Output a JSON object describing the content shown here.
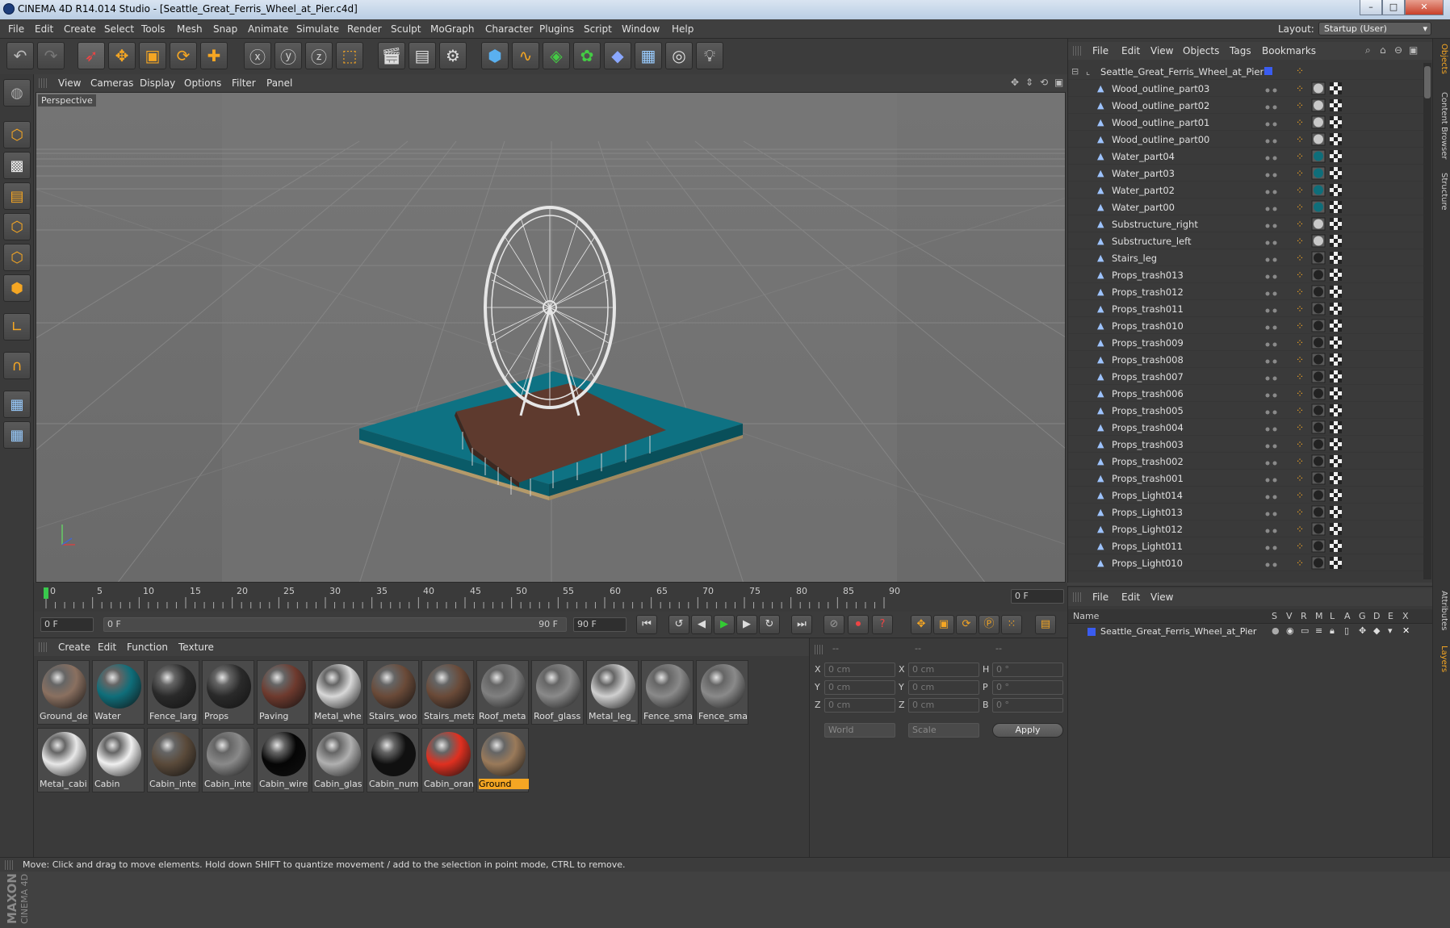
{
  "window": {
    "title": "CINEMA 4D R14.014 Studio - [Seattle_Great_Ferris_Wheel_at_Pier.c4d]",
    "min": "–",
    "max": "□",
    "close": "✕"
  },
  "menubar": {
    "items": [
      "File",
      "Edit",
      "Create",
      "Select",
      "Tools",
      "Mesh",
      "Snap",
      "Animate",
      "Simulate",
      "Render",
      "Sculpt",
      "MoGraph",
      "Character",
      "Plugins",
      "Script",
      "Window",
      "Help"
    ],
    "layout_label": "Layout:",
    "layout_value": "Startup (User)"
  },
  "viewport": {
    "menu": [
      "View",
      "Cameras",
      "Display",
      "Options",
      "Filter",
      "Panel"
    ],
    "label": "Perspective"
  },
  "timeline": {
    "ticks": [
      "0",
      "5",
      "10",
      "15",
      "20",
      "25",
      "30",
      "35",
      "40",
      "45",
      "50",
      "55",
      "60",
      "65",
      "70",
      "75",
      "80",
      "85",
      "90"
    ],
    "frame_field": "0 F"
  },
  "transport": {
    "start": "0 F",
    "range_start": "0 F",
    "range_end": "90 F",
    "end": "90 F"
  },
  "materials": {
    "menu": [
      "Create",
      "Edit",
      "Function",
      "Texture"
    ],
    "items": [
      {
        "name": "Ground_de",
        "color": "#8a7060"
      },
      {
        "name": "Water",
        "color": "#0f6e7a"
      },
      {
        "name": "Fence_larg",
        "color": "#2a2a2a"
      },
      {
        "name": "Props",
        "color": "#2a2a2a"
      },
      {
        "name": "Paving",
        "color": "#6e3a2e"
      },
      {
        "name": "Metal_whe",
        "color": "#d8d8d8"
      },
      {
        "name": "Stairs_woo",
        "color": "#6a4a38"
      },
      {
        "name": "Stairs_meta",
        "color": "#6a4a38"
      },
      {
        "name": "Roof_meta",
        "color": "#808080"
      },
      {
        "name": "Roof_glass",
        "color": "#8a8a8a"
      },
      {
        "name": "Metal_leg_",
        "color": "#d0d0d0"
      },
      {
        "name": "Fence_sma",
        "color": "#8a8a8a"
      },
      {
        "name": "Fence_sma",
        "color": "#8a8a8a"
      },
      {
        "name": "Metal_cabi",
        "color": "#e8e8e8"
      },
      {
        "name": "Cabin",
        "color": "#f0f0f0"
      },
      {
        "name": "Cabin_inte",
        "color": "#5a4a3a"
      },
      {
        "name": "Cabin_inte",
        "color": "#8a8a8a"
      },
      {
        "name": "Cabin_wire",
        "color": "#050505"
      },
      {
        "name": "Cabin_glas",
        "color": "#b0b0b0"
      },
      {
        "name": "Cabin_num",
        "color": "#101010"
      },
      {
        "name": "Cabin_oran",
        "color": "#e03020"
      },
      {
        "name": "Ground",
        "color": "#9a7a5a"
      }
    ]
  },
  "attributes": {
    "header": [
      "--",
      "--",
      "--"
    ],
    "rows": [
      {
        "a": "X",
        "av": "0 cm",
        "b": "X",
        "bv": "0 cm",
        "c": "H",
        "cv": "0 °"
      },
      {
        "a": "Y",
        "av": "0 cm",
        "b": "Y",
        "bv": "0 cm",
        "c": "P",
        "cv": "0 °"
      },
      {
        "a": "Z",
        "av": "0 cm",
        "b": "Z",
        "bv": "0 cm",
        "c": "B",
        "cv": "0 °"
      }
    ],
    "world": "World",
    "scale": "Scale",
    "apply": "Apply"
  },
  "objects": {
    "menu": [
      "File",
      "Edit",
      "View",
      "Objects",
      "Tags",
      "Bookmarks"
    ],
    "root": "Seattle_Great_Ferris_Wheel_at_Pier",
    "items": [
      {
        "name": "Wood_outline_part03",
        "mat": "#c8c8c8"
      },
      {
        "name": "Wood_outline_part02",
        "mat": "#c8c8c8"
      },
      {
        "name": "Wood_outline_part01",
        "mat": "#c8c8c8"
      },
      {
        "name": "Wood_outline_part00",
        "mat": "#c8c8c8"
      },
      {
        "name": "Water_part04",
        "mat": "#0f6e7a"
      },
      {
        "name": "Water_part03",
        "mat": "#0f6e7a"
      },
      {
        "name": "Water_part02",
        "mat": "#0f6e7a"
      },
      {
        "name": "Water_part00",
        "mat": "#0f6e7a"
      },
      {
        "name": "Substructure_right",
        "mat": "#c8c8c8"
      },
      {
        "name": "Substructure_left",
        "mat": "#c8c8c8"
      },
      {
        "name": "Stairs_leg",
        "mat": "#222222"
      },
      {
        "name": "Props_trash013",
        "mat": "#222222"
      },
      {
        "name": "Props_trash012",
        "mat": "#222222"
      },
      {
        "name": "Props_trash011",
        "mat": "#222222"
      },
      {
        "name": "Props_trash010",
        "mat": "#222222"
      },
      {
        "name": "Props_trash009",
        "mat": "#222222"
      },
      {
        "name": "Props_trash008",
        "mat": "#222222"
      },
      {
        "name": "Props_trash007",
        "mat": "#222222"
      },
      {
        "name": "Props_trash006",
        "mat": "#222222"
      },
      {
        "name": "Props_trash005",
        "mat": "#222222"
      },
      {
        "name": "Props_trash004",
        "mat": "#222222"
      },
      {
        "name": "Props_trash003",
        "mat": "#222222"
      },
      {
        "name": "Props_trash002",
        "mat": "#222222"
      },
      {
        "name": "Props_trash001",
        "mat": "#222222"
      },
      {
        "name": "Props_Light014",
        "mat": "#222222"
      },
      {
        "name": "Props_Light013",
        "mat": "#222222"
      },
      {
        "name": "Props_Light012",
        "mat": "#222222"
      },
      {
        "name": "Props_Light011",
        "mat": "#222222"
      },
      {
        "name": "Props_Light010",
        "mat": "#222222"
      }
    ]
  },
  "layers": {
    "menu": [
      "File",
      "Edit",
      "View"
    ],
    "name_header": "Name",
    "columns": [
      "S",
      "V",
      "R",
      "M",
      "L",
      "A",
      "G",
      "D",
      "E",
      "X"
    ],
    "row": "Seattle_Great_Ferris_Wheel_at_Pier"
  },
  "right_tabs": [
    "Objects",
    "Content Browser",
    "Structure",
    "Attributes",
    "Layers"
  ],
  "status": "Move: Click and drag to move elements. Hold down SHIFT to quantize movement / add to the selection in point mode, CTRL to remove.",
  "maxon_text": "MAXON",
  "cinema_text": "CINEMA 4D"
}
